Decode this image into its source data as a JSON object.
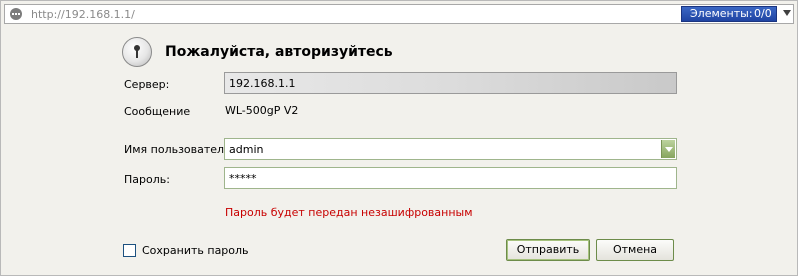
{
  "address_bar": {
    "url": "http://192.168.1.1/",
    "items_label": "Элементы:",
    "items_count": "0/0"
  },
  "dialog": {
    "title": "Пожалуйста, авторизуйтесь",
    "server_label": "Сервер:",
    "server_value": "192.168.1.1",
    "message_label": "Сообщение",
    "message_value": "WL-500gP V2",
    "username_label": "Имя пользователя:",
    "username_value": "admin",
    "password_label": "Пароль:",
    "password_value": "*****",
    "warning": "Пароль будет передан незашифрованным",
    "save_password_label": "Сохранить пароль",
    "save_password_checked": false,
    "send_button": "Отправить",
    "cancel_button": "Отмена"
  },
  "colors": {
    "warning": "#c80000",
    "items_button": "#2a52b4",
    "button_border": "#6d8c4a"
  }
}
